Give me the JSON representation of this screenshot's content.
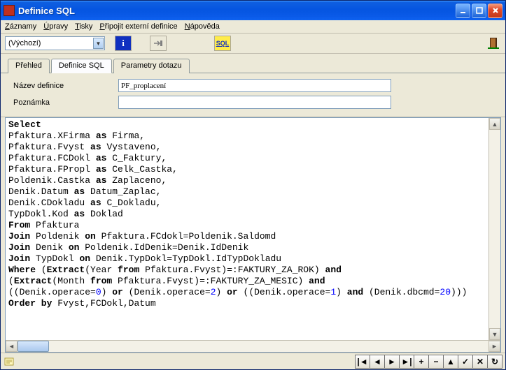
{
  "window": {
    "title": "Definice SQL"
  },
  "menu": {
    "zaznamy": "Záznamy",
    "upravy": "Úpravy",
    "tisky": "Tisky",
    "pripojit": "Připojit externí definice",
    "napoveda": "Nápověda"
  },
  "toolbar": {
    "combo_value": "(Výchozí)",
    "info_label": "i",
    "sql_label": "SQL"
  },
  "tabs": {
    "prehled": "Přehled",
    "definice": "Definice SQL",
    "parametry": "Parametry dotazu"
  },
  "form": {
    "nazev_label": "Název definice",
    "nazev_value": "PF_proplacení",
    "poznamka_label": "Poznámka",
    "poznamka_value": ""
  },
  "sql": {
    "lines": [
      [
        {
          "t": "Select",
          "b": 1
        }
      ],
      [
        {
          "t": "Pfaktura.XFirma "
        },
        {
          "t": "as",
          "b": 1
        },
        {
          "t": " Firma,"
        }
      ],
      [
        {
          "t": "Pfaktura.Fvyst "
        },
        {
          "t": "as",
          "b": 1
        },
        {
          "t": " Vystaveno,"
        }
      ],
      [
        {
          "t": "Pfaktura.FCDokl "
        },
        {
          "t": "as",
          "b": 1
        },
        {
          "t": " C_Faktury,"
        }
      ],
      [
        {
          "t": "Pfaktura.FPropl "
        },
        {
          "t": "as",
          "b": 1
        },
        {
          "t": " Celk_Castka,"
        }
      ],
      [
        {
          "t": "Poldenik.Castka "
        },
        {
          "t": "as",
          "b": 1
        },
        {
          "t": " Zaplaceno,"
        }
      ],
      [
        {
          "t": "Denik.Datum "
        },
        {
          "t": "as",
          "b": 1
        },
        {
          "t": " Datum_Zaplac,"
        }
      ],
      [
        {
          "t": "Denik.CDokladu "
        },
        {
          "t": "as",
          "b": 1
        },
        {
          "t": " C_Dokladu,"
        }
      ],
      [
        {
          "t": "TypDokl.Kod "
        },
        {
          "t": "as",
          "b": 1
        },
        {
          "t": " Doklad"
        }
      ],
      [
        {
          "t": "From",
          "b": 1
        },
        {
          "t": " Pfaktura"
        }
      ],
      [
        {
          "t": "Join",
          "b": 1
        },
        {
          "t": " Poldenik "
        },
        {
          "t": "on",
          "b": 1
        },
        {
          "t": " Pfaktura.FCdokl=Poldenik.Saldomd"
        }
      ],
      [
        {
          "t": "Join",
          "b": 1
        },
        {
          "t": " Denik "
        },
        {
          "t": "on",
          "b": 1
        },
        {
          "t": " Poldenik.IdDenik=Denik.IdDenik"
        }
      ],
      [
        {
          "t": "Join",
          "b": 1
        },
        {
          "t": " TypDokl "
        },
        {
          "t": "on",
          "b": 1
        },
        {
          "t": " Denik.TypDokl=TypDokl.IdTypDokladu"
        }
      ],
      [
        {
          "t": "Where",
          "b": 1
        },
        {
          "t": " ("
        },
        {
          "t": "Extract",
          "b": 1
        },
        {
          "t": "(Year "
        },
        {
          "t": "from",
          "b": 1
        },
        {
          "t": " Pfaktura.Fvyst)=:FAKTURY_ZA_ROK) "
        },
        {
          "t": "and",
          "b": 1
        }
      ],
      [
        {
          "t": "("
        },
        {
          "t": "Extract",
          "b": 1
        },
        {
          "t": "(Month "
        },
        {
          "t": "from",
          "b": 1
        },
        {
          "t": " Pfaktura.Fvyst)=:FAKTURY_ZA_MESIC) "
        },
        {
          "t": "and",
          "b": 1
        }
      ],
      [
        {
          "t": "((Denik.operace="
        },
        {
          "t": "0",
          "n": 1
        },
        {
          "t": ") "
        },
        {
          "t": "or",
          "b": 1
        },
        {
          "t": " (Denik.operace="
        },
        {
          "t": "2",
          "n": 1
        },
        {
          "t": ") "
        },
        {
          "t": "or",
          "b": 1
        },
        {
          "t": " ((Denik.operace="
        },
        {
          "t": "1",
          "n": 1
        },
        {
          "t": ") "
        },
        {
          "t": "and",
          "b": 1
        },
        {
          "t": " (Denik.dbcmd="
        },
        {
          "t": "20",
          "n": 1
        },
        {
          "t": ")))"
        }
      ],
      [
        {
          "t": "Order by",
          "b": 1
        },
        {
          "t": " Fvyst,FCDokl,Datum"
        }
      ]
    ]
  },
  "nav": {
    "first": "|◄",
    "prev": "◄",
    "next": "►",
    "last": "►|",
    "plus": "+",
    "minus": "−",
    "edit": "▲",
    "ok": "✓",
    "cancel": "✕",
    "refresh": "↻"
  }
}
